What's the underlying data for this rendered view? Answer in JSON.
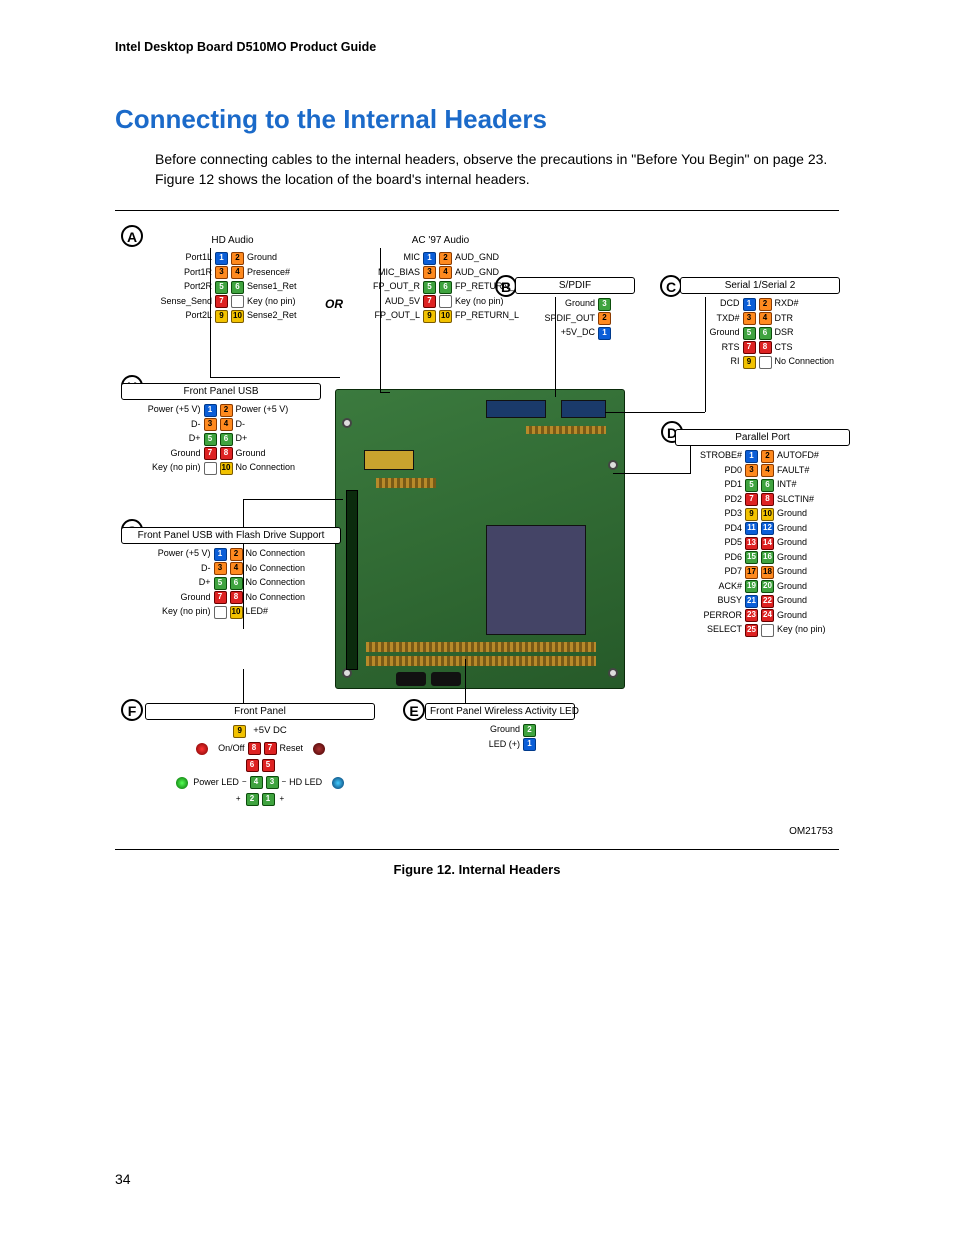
{
  "doc_header": "Intel Desktop Board D510MO Product Guide",
  "h1": "Connecting to the Internal Headers",
  "intro": "Before connecting cables to the internal headers, observe the precautions in \"Before You Begin\" on page 23.  Figure 12 shows the location of the board's internal headers.",
  "caption": "Figure 12.  Internal Headers",
  "page_number": "34",
  "om_code": "OM21753",
  "or_text": "OR",
  "bubbles": {
    "A": "A",
    "B": "B",
    "C": "C",
    "D": "D",
    "E": "E",
    "F": "F",
    "G": "G",
    "H": "H"
  },
  "A_hd": {
    "title": "HD Audio",
    "rows": [
      {
        "l": "Port1L",
        "p": [
          1,
          2
        ],
        "r": "Ground"
      },
      {
        "l": "Port1R",
        "p": [
          3,
          4
        ],
        "r": "Presence#"
      },
      {
        "l": "Port2R",
        "p": [
          5,
          6
        ],
        "r": "Sense1_Ret"
      },
      {
        "l": "Sense_Send",
        "p": [
          7,
          null
        ],
        "r": "Key (no pin)"
      },
      {
        "l": "Port2L",
        "p": [
          9,
          10
        ],
        "r": "Sense2_Ret"
      }
    ]
  },
  "A_ac": {
    "title": "AC '97 Audio",
    "rows": [
      {
        "l": "MIC",
        "p": [
          1,
          2
        ],
        "r": "AUD_GND"
      },
      {
        "l": "MIC_BIAS",
        "p": [
          3,
          4
        ],
        "r": "AUD_GND"
      },
      {
        "l": "FP_OUT_R",
        "p": [
          5,
          6
        ],
        "r": "FP_RETURN_R"
      },
      {
        "l": "AUD_5V",
        "p": [
          7,
          null
        ],
        "r": "Key (no pin)"
      },
      {
        "l": "FP_OUT_L",
        "p": [
          9,
          10
        ],
        "r": "FP_RETURN_L"
      }
    ]
  },
  "B": {
    "title": "S/PDIF",
    "rows": [
      {
        "l": "Ground",
        "p": [
          3
        ]
      },
      {
        "l": "SPDIF_OUT",
        "p": [
          2
        ]
      },
      {
        "l": "+5V_DC",
        "p": [
          1
        ]
      }
    ]
  },
  "C": {
    "title": "Serial 1/Serial 2",
    "rows": [
      {
        "l": "DCD",
        "p": [
          1,
          2
        ],
        "r": "RXD#"
      },
      {
        "l": "TXD#",
        "p": [
          3,
          4
        ],
        "r": "DTR"
      },
      {
        "l": "Ground",
        "p": [
          5,
          6
        ],
        "r": "DSR"
      },
      {
        "l": "RTS",
        "p": [
          7,
          8
        ],
        "r": "CTS"
      },
      {
        "l": "RI",
        "p": [
          9,
          null
        ],
        "r": "No Connection"
      }
    ]
  },
  "D": {
    "title": "Parallel Port",
    "rows": [
      {
        "l": "STROBE#",
        "p": [
          1,
          2
        ],
        "r": "AUTOFD#"
      },
      {
        "l": "PD0",
        "p": [
          3,
          4
        ],
        "r": "FAULT#"
      },
      {
        "l": "PD1",
        "p": [
          5,
          6
        ],
        "r": "INT#"
      },
      {
        "l": "PD2",
        "p": [
          7,
          8
        ],
        "r": "SLCTIN#"
      },
      {
        "l": "PD3",
        "p": [
          9,
          10
        ],
        "r": "Ground"
      },
      {
        "l": "PD4",
        "p": [
          11,
          12
        ],
        "r": "Ground"
      },
      {
        "l": "PD5",
        "p": [
          13,
          14
        ],
        "r": "Ground"
      },
      {
        "l": "PD6",
        "p": [
          15,
          16
        ],
        "r": "Ground"
      },
      {
        "l": "PD7",
        "p": [
          17,
          18
        ],
        "r": "Ground"
      },
      {
        "l": "ACK#",
        "p": [
          19,
          20
        ],
        "r": "Ground"
      },
      {
        "l": "BUSY",
        "p": [
          21,
          22
        ],
        "r": "Ground"
      },
      {
        "l": "PERROR",
        "p": [
          23,
          24
        ],
        "r": "Ground"
      },
      {
        "l": "SELECT",
        "p": [
          25,
          null
        ],
        "r": "Key (no pin)"
      }
    ]
  },
  "E": {
    "title": "Front Panel Wireless Activity LED",
    "rows": [
      {
        "l": "Ground",
        "p": [
          2
        ]
      },
      {
        "l": "LED (+)",
        "p": [
          1
        ]
      }
    ]
  },
  "F": {
    "title": "Front Panel",
    "labels": {
      "p9": "+5V DC",
      "p8": "8",
      "p7": "7",
      "p6": "6",
      "p5": "5",
      "p4": "4",
      "p3": "3",
      "p2": "2",
      "p1": "1",
      "onoff": "On/Off",
      "reset": "Reset",
      "pwrled": "Power LED",
      "hdled": "HD LED",
      "plus": "+",
      "minus": "−"
    }
  },
  "G": {
    "title": "Front Panel USB with Flash Drive Support",
    "rows": [
      {
        "l": "Power (+5 V)",
        "p": [
          1,
          2
        ],
        "r": "No Connection"
      },
      {
        "l": "D-",
        "p": [
          3,
          4
        ],
        "r": "No Connection"
      },
      {
        "l": "D+",
        "p": [
          5,
          6
        ],
        "r": "No Connection"
      },
      {
        "l": "Ground",
        "p": [
          7,
          8
        ],
        "r": "No Connection"
      },
      {
        "l": "Key (no pin)",
        "p": [
          null,
          10
        ],
        "r": "LED#"
      }
    ]
  },
  "H": {
    "title": "Front Panel USB",
    "rows": [
      {
        "l": "Power (+5 V)",
        "p": [
          1,
          2
        ],
        "r": "Power (+5 V)"
      },
      {
        "l": "D-",
        "p": [
          3,
          4
        ],
        "r": "D-"
      },
      {
        "l": "D+",
        "p": [
          5,
          6
        ],
        "r": "D+"
      },
      {
        "l": "Ground",
        "p": [
          7,
          8
        ],
        "r": "Ground"
      },
      {
        "l": "Key (no pin)",
        "p": [
          null,
          10
        ],
        "r": "No Connection"
      }
    ]
  }
}
